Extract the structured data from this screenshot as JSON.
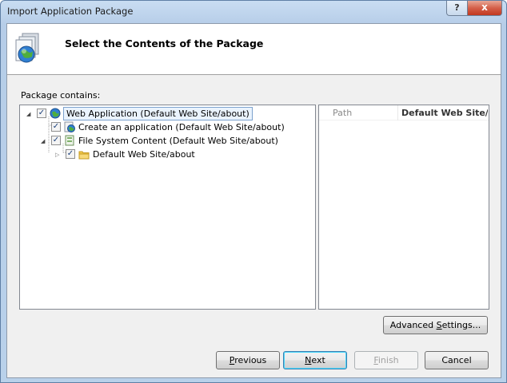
{
  "window": {
    "title": "Import Application Package",
    "help_glyph": "?",
    "close_glyph": "x"
  },
  "header": {
    "title": "Select the Contents of the Package",
    "icon": "package-install-icon"
  },
  "tree": {
    "label": "Package contains:",
    "nodes": [
      {
        "label": "Web Application (Default Web Site/about)",
        "checked": true,
        "expanded": true,
        "icon": "globe-icon"
      },
      {
        "label": "Create an application (Default Web Site/about)",
        "checked": true,
        "icon": "app-globe-icon"
      },
      {
        "label": "File System Content (Default Web Site/about)",
        "checked": true,
        "expanded": true,
        "icon": "file-system-icon"
      },
      {
        "label": "Default Web Site/about",
        "checked": true,
        "expanded": false,
        "icon": "folder-icon"
      }
    ]
  },
  "properties": {
    "key": "Path",
    "value": "Default Web Site/about"
  },
  "buttons": {
    "advanced_prefix": "Advanced ",
    "advanced_underline": "S",
    "advanced_suffix": "ettings...",
    "previous_underline": "P",
    "previous_suffix": "revious",
    "next_underline": "N",
    "next_suffix": "ext",
    "finish_underline": "F",
    "finish_suffix": "inish",
    "cancel": "Cancel"
  },
  "colors": {
    "accent": "#3c7fb1",
    "close": "#c2381f",
    "selection": "#7da2ce"
  }
}
